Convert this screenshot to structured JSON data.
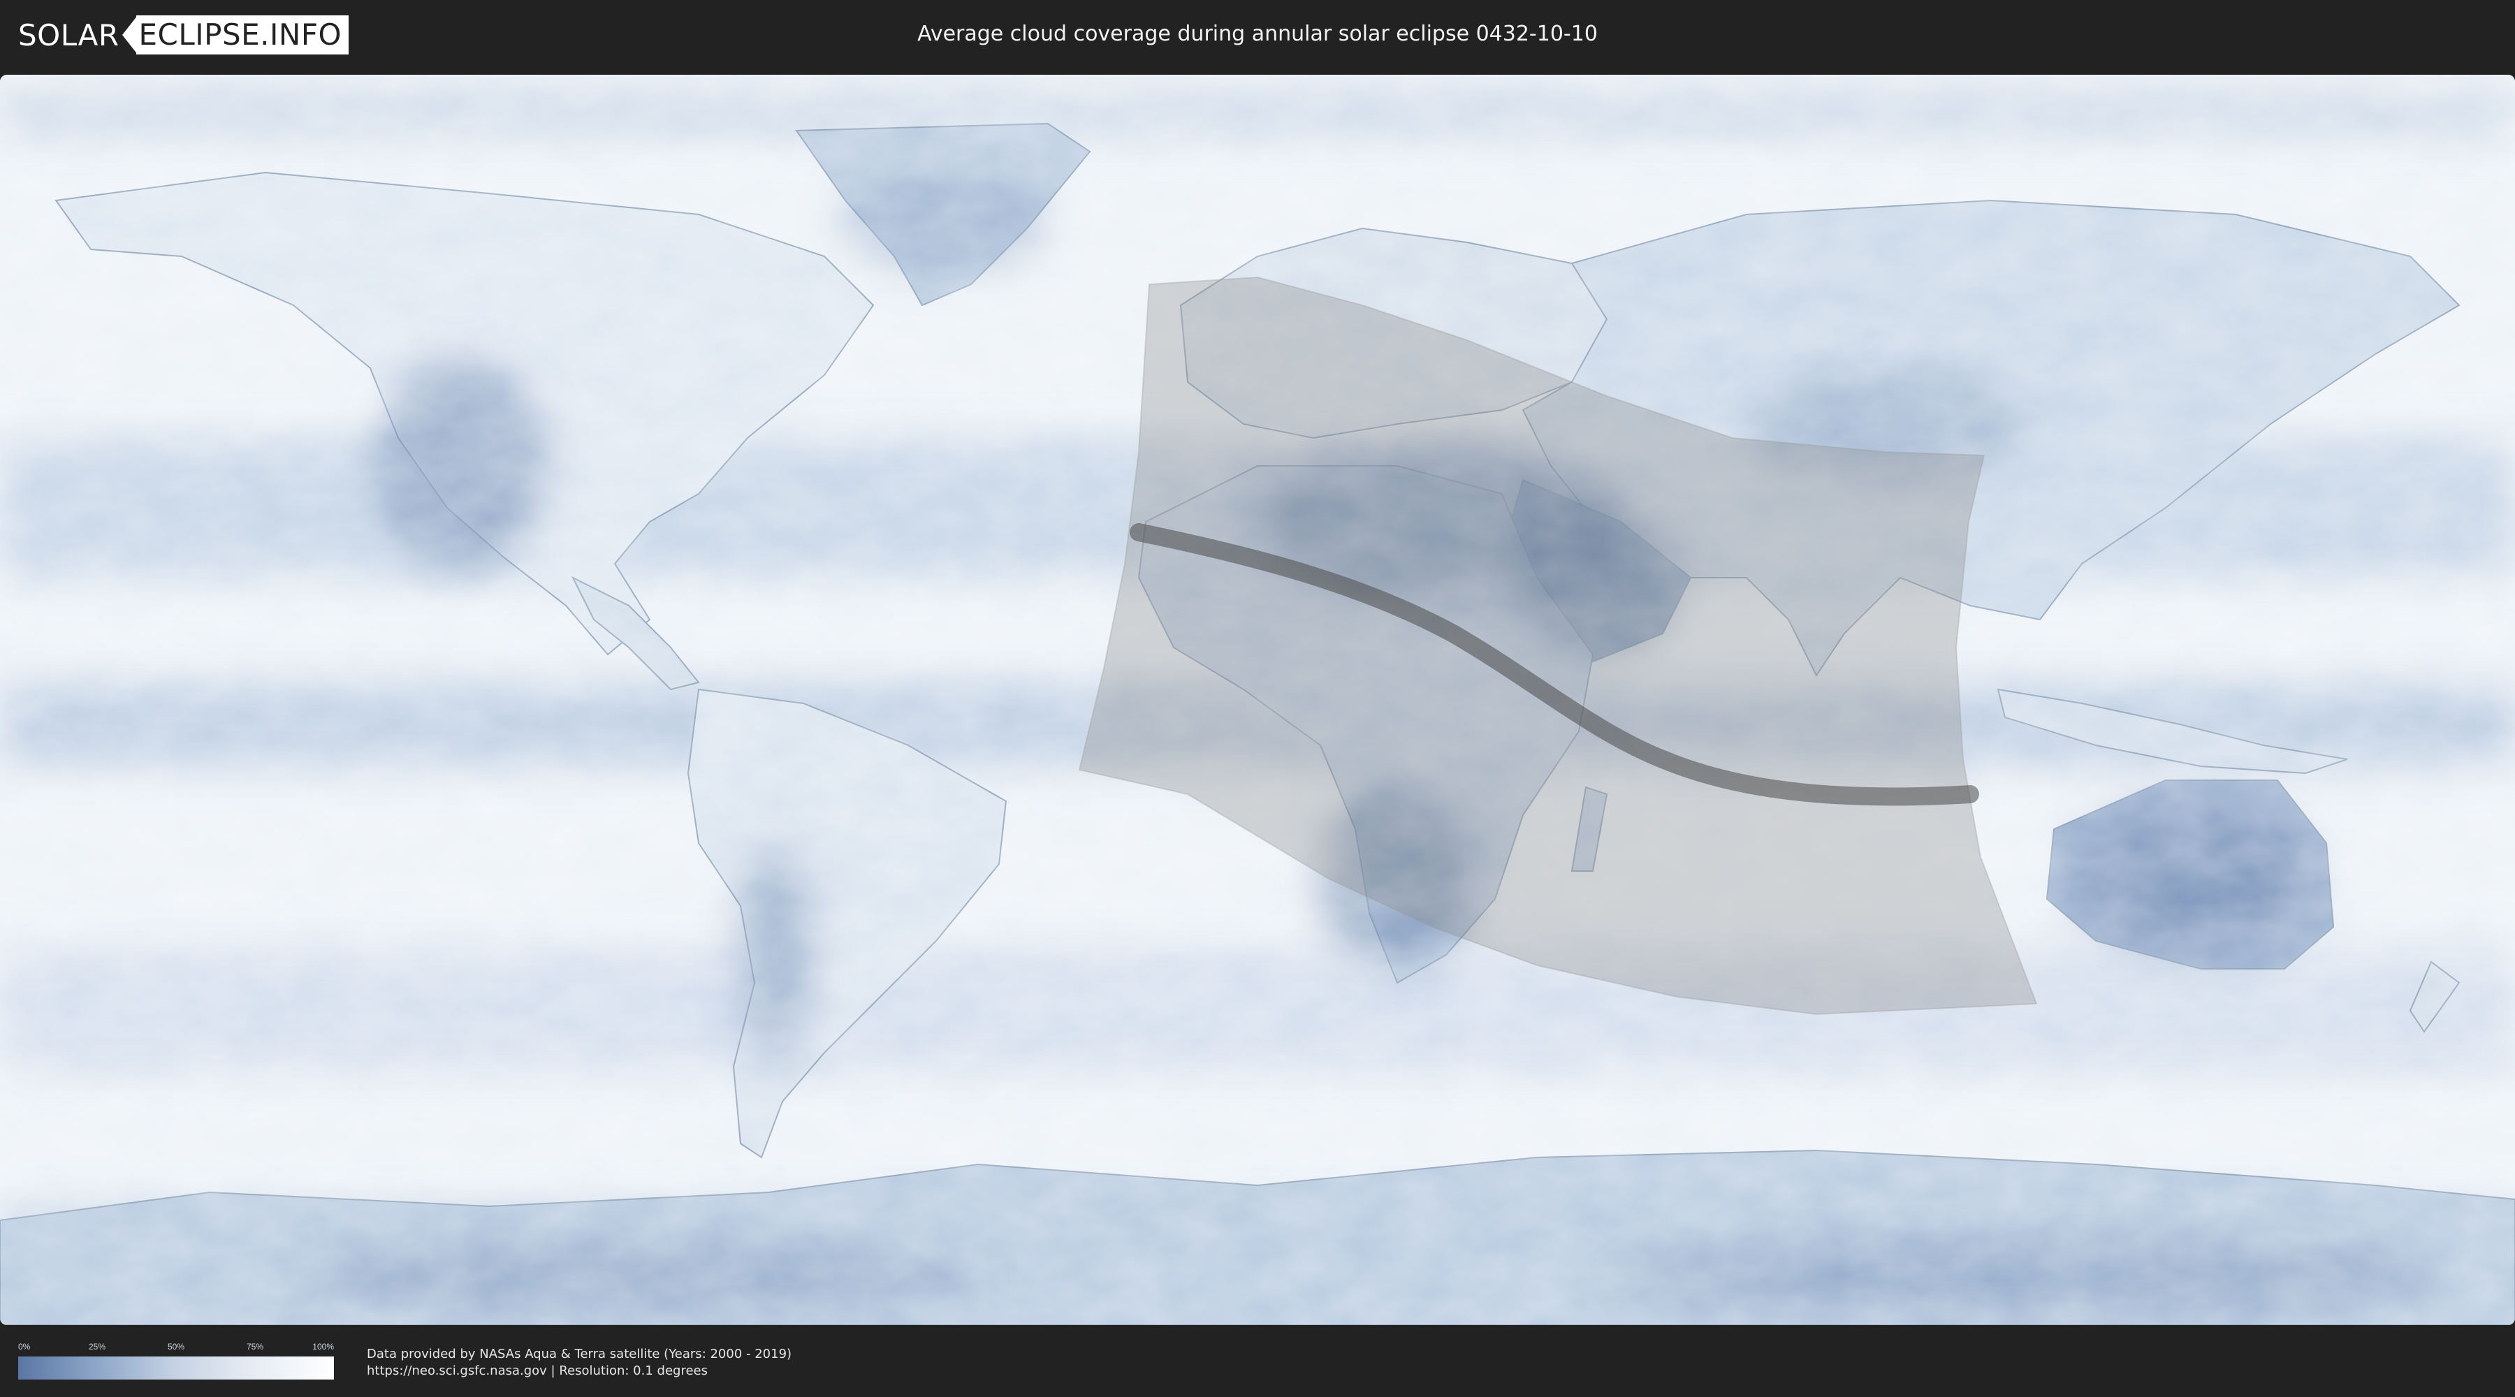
{
  "header": {
    "logo_part1": "SOLAR",
    "logo_part2": "ECLIPSE.INFO",
    "title": "Average cloud coverage during annular solar eclipse 0432-10-10"
  },
  "map": {
    "type": "world cloud-coverage map",
    "colors": {
      "clear_sky": "#5a76a4",
      "full_cloud": "#ffffff",
      "shadow_region": "#8c8c8c",
      "annularity_path": "#4d4d4d"
    }
  },
  "legend": {
    "ticks": [
      "0%",
      "25%",
      "50%",
      "75%",
      "100%"
    ]
  },
  "footer": {
    "credit_line1": "Data provided by NASAs Aqua & Terra satellite (Years: 2000 - 2019)",
    "credit_line2": "https://neo.sci.gsfc.nasa.gov | Resolution: 0.1 degrees"
  }
}
